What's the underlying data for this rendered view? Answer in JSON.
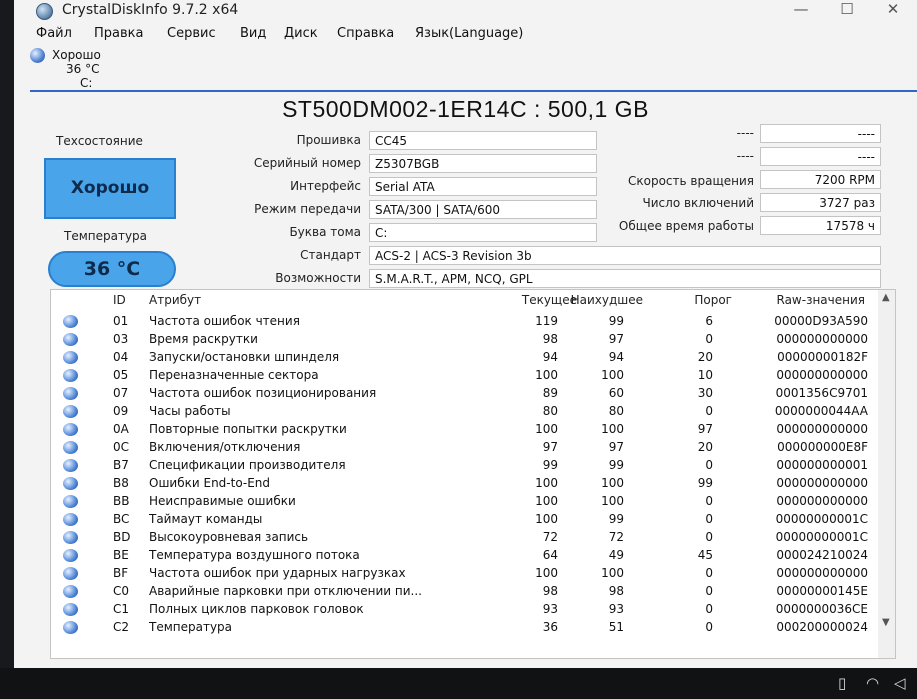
{
  "window": {
    "title": "CrystalDiskInfo 9.7.2 x64",
    "minimize": "—",
    "maximize": "☐",
    "close": "✕"
  },
  "menu": [
    "Файл",
    "Правка",
    "Сервис",
    "Вид",
    "Диск",
    "Справка",
    "Язык(Language)"
  ],
  "drive_tab": {
    "status": "Хорошо",
    "temp": "36 °C",
    "letter": "C:"
  },
  "model": "ST500DM002-1ER14C : 500,1 GB",
  "health": {
    "label": "Техсостояние",
    "value": "Хорошо"
  },
  "temperature": {
    "label": "Температура",
    "value": "36 °C"
  },
  "info": {
    "firmware": {
      "label": "Прошивка",
      "value": "CC45"
    },
    "serial": {
      "label": "Серийный номер",
      "value": "Z5307BGB"
    },
    "interface": {
      "label": "Интерфейс",
      "value": "Serial ATA"
    },
    "transfer": {
      "label": "Режим передачи",
      "value": "SATA/300 | SATA/600"
    },
    "volume": {
      "label": "Буква тома",
      "value": "C:"
    },
    "standard": {
      "label": "Стандарт",
      "value": "ACS-2 | ACS-3 Revision 3b"
    },
    "features": {
      "label": "Возможности",
      "value": "S.M.A.R.T., APM, NCQ, GPL"
    }
  },
  "right_info": {
    "blank1": {
      "label": "----",
      "value": "----"
    },
    "blank2": {
      "label": "----",
      "value": "----"
    },
    "rotation": {
      "label": "Скорость вращения",
      "value": "7200 RPM"
    },
    "power_count": {
      "label": "Число включений",
      "value": "3727 раз"
    },
    "power_hours": {
      "label": "Общее время работы",
      "value": "17578 ч"
    }
  },
  "table": {
    "headers": {
      "id": "ID",
      "attr": "Атрибут",
      "current": "Текущее",
      "worst": "Наихудшее",
      "threshold": "Порог",
      "raw": "Raw-значения"
    },
    "rows": [
      {
        "id": "01",
        "name": "Частота ошибок чтения",
        "current": "119",
        "worst": "99",
        "threshold": "6",
        "raw": "00000D93A590"
      },
      {
        "id": "03",
        "name": "Время раскрутки",
        "current": "98",
        "worst": "97",
        "threshold": "0",
        "raw": "000000000000"
      },
      {
        "id": "04",
        "name": "Запуски/остановки шпинделя",
        "current": "94",
        "worst": "94",
        "threshold": "20",
        "raw": "00000000182F"
      },
      {
        "id": "05",
        "name": "Переназначенные сектора",
        "current": "100",
        "worst": "100",
        "threshold": "10",
        "raw": "000000000000"
      },
      {
        "id": "07",
        "name": "Частота ошибок позиционирования",
        "current": "89",
        "worst": "60",
        "threshold": "30",
        "raw": "0001356C9701"
      },
      {
        "id": "09",
        "name": "Часы работы",
        "current": "80",
        "worst": "80",
        "threshold": "0",
        "raw": "0000000044AA"
      },
      {
        "id": "0A",
        "name": "Повторные попытки раскрутки",
        "current": "100",
        "worst": "100",
        "threshold": "97",
        "raw": "000000000000"
      },
      {
        "id": "0C",
        "name": "Включения/отключения",
        "current": "97",
        "worst": "97",
        "threshold": "20",
        "raw": "000000000E8F"
      },
      {
        "id": "B7",
        "name": "Спецификации производителя",
        "current": "99",
        "worst": "99",
        "threshold": "0",
        "raw": "000000000001"
      },
      {
        "id": "B8",
        "name": "Ошибки End-to-End",
        "current": "100",
        "worst": "100",
        "threshold": "99",
        "raw": "000000000000"
      },
      {
        "id": "BB",
        "name": "Неисправимые ошибки",
        "current": "100",
        "worst": "100",
        "threshold": "0",
        "raw": "000000000000"
      },
      {
        "id": "BC",
        "name": "Таймаут команды",
        "current": "100",
        "worst": "99",
        "threshold": "0",
        "raw": "00000000001C"
      },
      {
        "id": "BD",
        "name": "Высокоуровневая запись",
        "current": "72",
        "worst": "72",
        "threshold": "0",
        "raw": "00000000001C"
      },
      {
        "id": "BE",
        "name": "Температура воздушного потока",
        "current": "64",
        "worst": "49",
        "threshold": "45",
        "raw": "000024210024"
      },
      {
        "id": "BF",
        "name": "Частота ошибок при ударных нагрузках",
        "current": "100",
        "worst": "100",
        "threshold": "0",
        "raw": "000000000000"
      },
      {
        "id": "C0",
        "name": "Аварийные парковки при отключении пи...",
        "current": "98",
        "worst": "98",
        "threshold": "0",
        "raw": "00000000145E"
      },
      {
        "id": "C1",
        "name": "Полных циклов парковок головок",
        "current": "93",
        "worst": "93",
        "threshold": "0",
        "raw": "0000000036CE"
      },
      {
        "id": "C2",
        "name": "Температура",
        "current": "36",
        "worst": "51",
        "threshold": "0",
        "raw": "000200000024"
      }
    ]
  }
}
